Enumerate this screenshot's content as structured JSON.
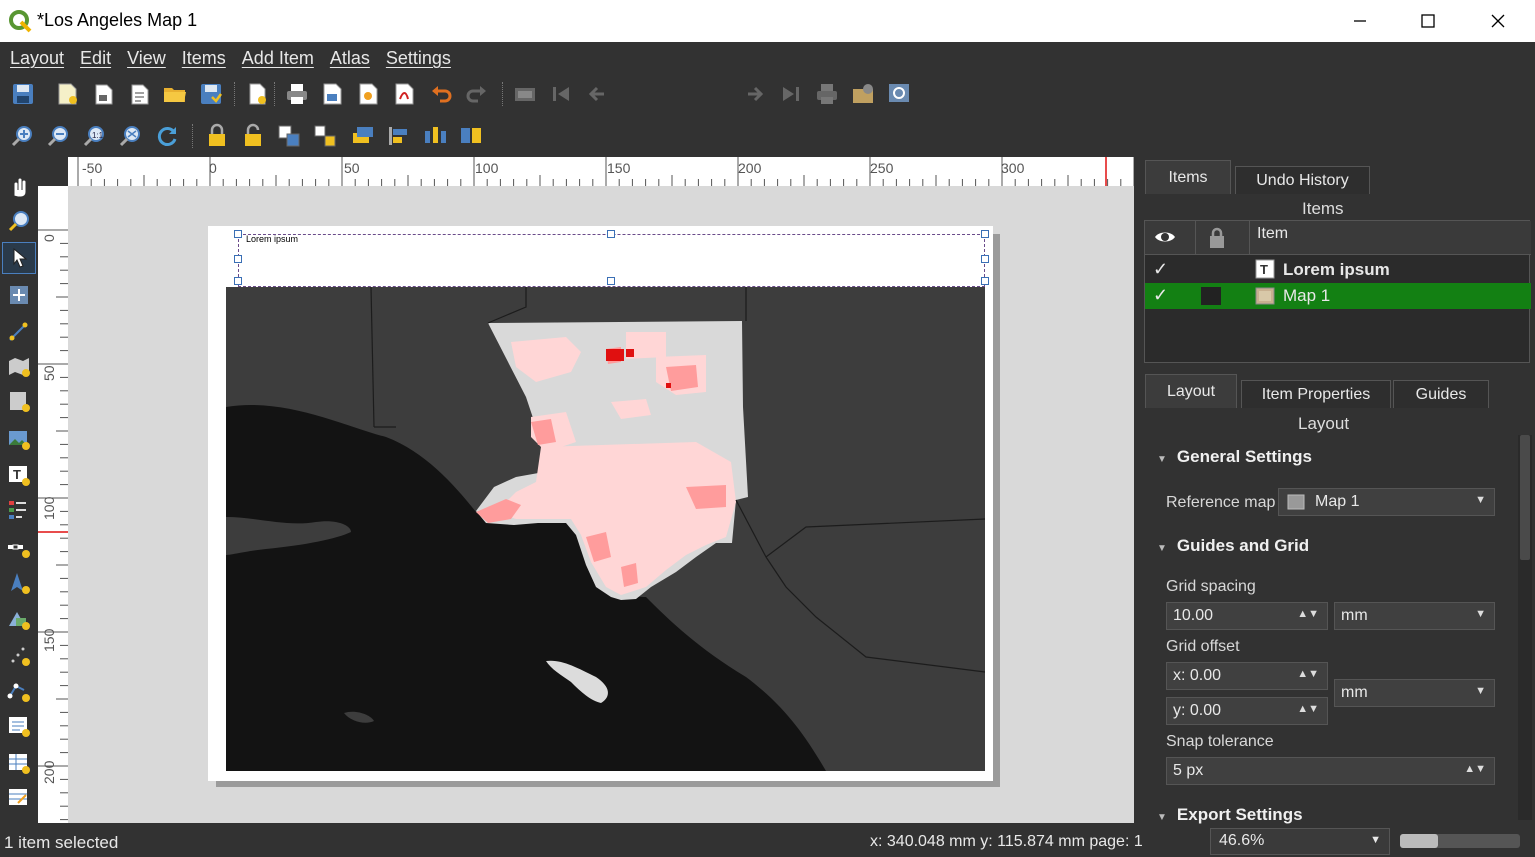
{
  "window": {
    "title": "*Los Angeles Map 1"
  },
  "menubar": {
    "items": [
      "Layout",
      "Edit",
      "View",
      "Items",
      "Add Item",
      "Atlas",
      "Settings"
    ]
  },
  "toolbar": {
    "page_number": "1"
  },
  "ruler": {
    "h_labels": [
      "-50",
      "0",
      "50",
      "100",
      "150",
      "200",
      "250",
      "300"
    ],
    "v_labels": [
      "0",
      "50",
      "100",
      "150",
      "200"
    ]
  },
  "layout_page": {
    "label_text": "Lorem ipsum"
  },
  "items_panel": {
    "tabs": [
      "Items",
      "Undo History"
    ],
    "title": "Items",
    "column_item": "Item",
    "rows": [
      {
        "name": "Lorem ipsum",
        "checked": true,
        "selected": false
      },
      {
        "name": "Map 1",
        "checked": true,
        "selected": true
      }
    ]
  },
  "layout_panel": {
    "tabs": [
      "Layout",
      "Item Properties",
      "Guides"
    ],
    "title": "Layout",
    "general_settings": "General Settings",
    "reference_map_label": "Reference map",
    "reference_map_value": "Map 1",
    "guides_and_grid": "Guides and Grid",
    "grid_spacing_label": "Grid spacing",
    "grid_spacing_value": "10.00",
    "grid_spacing_unit": "mm",
    "grid_offset_label": "Grid offset",
    "grid_offset_x": "x: 0.00",
    "grid_offset_y": "y: 0.00",
    "grid_offset_unit": "mm",
    "snap_tolerance_label": "Snap tolerance",
    "snap_tolerance_value": "5 px",
    "export_settings": "Export Settings"
  },
  "status": {
    "selection": "1 item selected",
    "coords": "x: 340.048 mm y: 115.874 mm page: 1",
    "zoom": "46.6%"
  },
  "colors": {
    "selection_green": "#1a8a1a",
    "accent_red": "#e01010",
    "qgis_green": "#589632"
  }
}
